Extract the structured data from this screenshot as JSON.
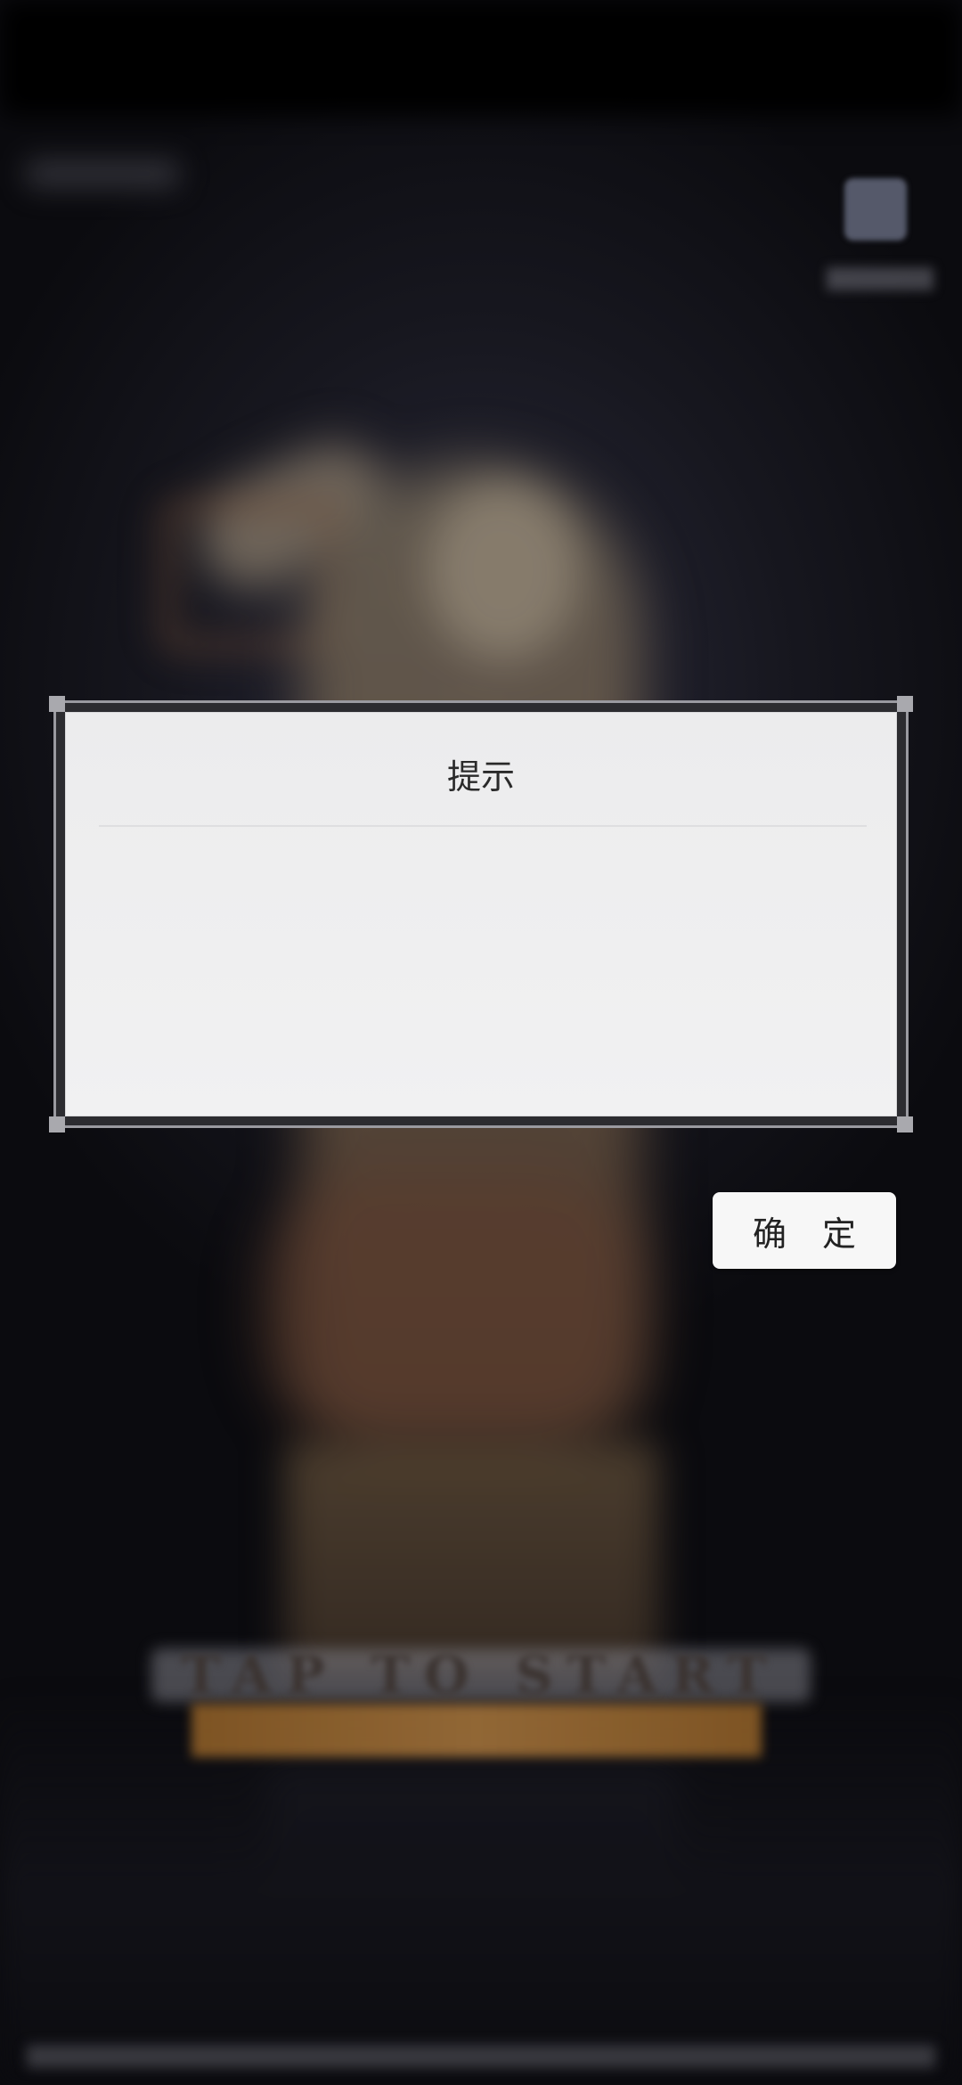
{
  "dialog": {
    "title": "提示",
    "message": "",
    "confirm_label": "确 定"
  },
  "background": {
    "start_prompt": "TAP TO START"
  },
  "colors": {
    "dialog_bg": "#f0f0f1",
    "frame": "#9a9aa0",
    "button_bg": "#f7f7f7",
    "overlay": "#0c0c10"
  }
}
